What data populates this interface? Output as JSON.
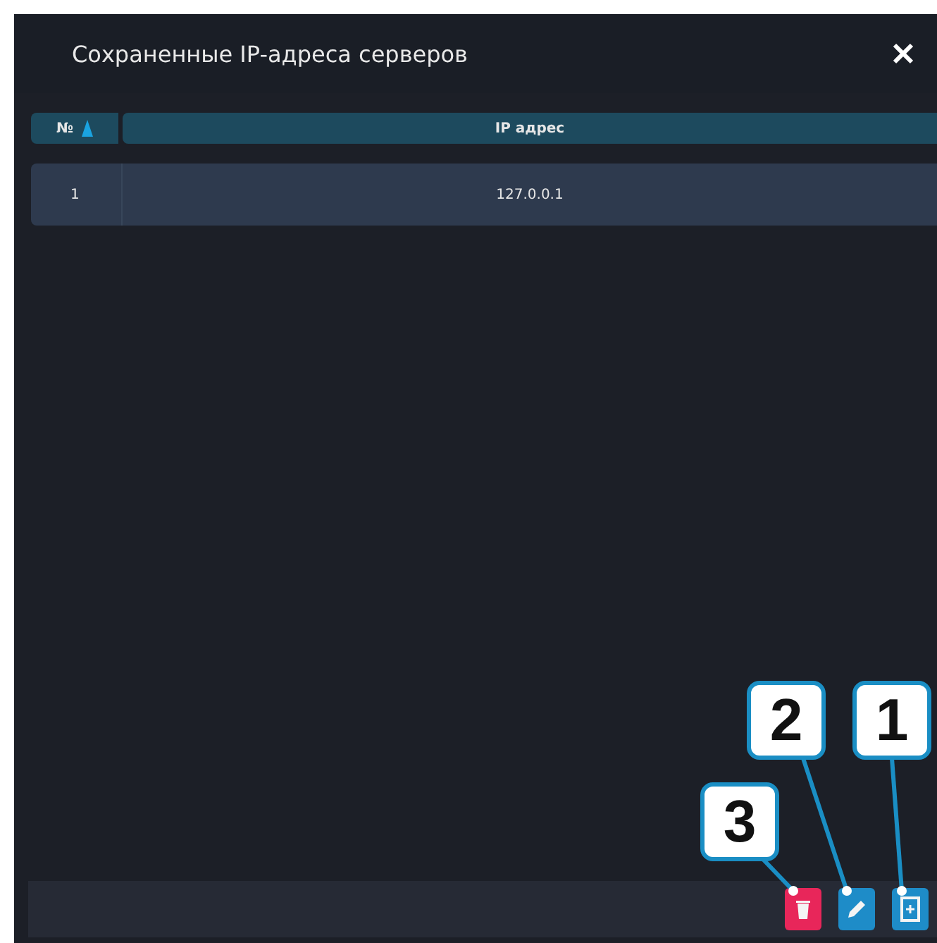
{
  "dialog": {
    "title": "Сохраненные IP-адреса серверов"
  },
  "table": {
    "columns": [
      {
        "label": "№",
        "sorted": true
      },
      {
        "label": "IP адрес",
        "sorted": false
      }
    ],
    "rows": [
      {
        "cells": [
          "1",
          "127.0.0.1"
        ],
        "selected": true
      }
    ]
  },
  "footer": {
    "buttons": [
      {
        "kind": "delete",
        "callout": "3"
      },
      {
        "kind": "edit",
        "callout": "2"
      },
      {
        "kind": "add",
        "callout": "1"
      }
    ]
  }
}
